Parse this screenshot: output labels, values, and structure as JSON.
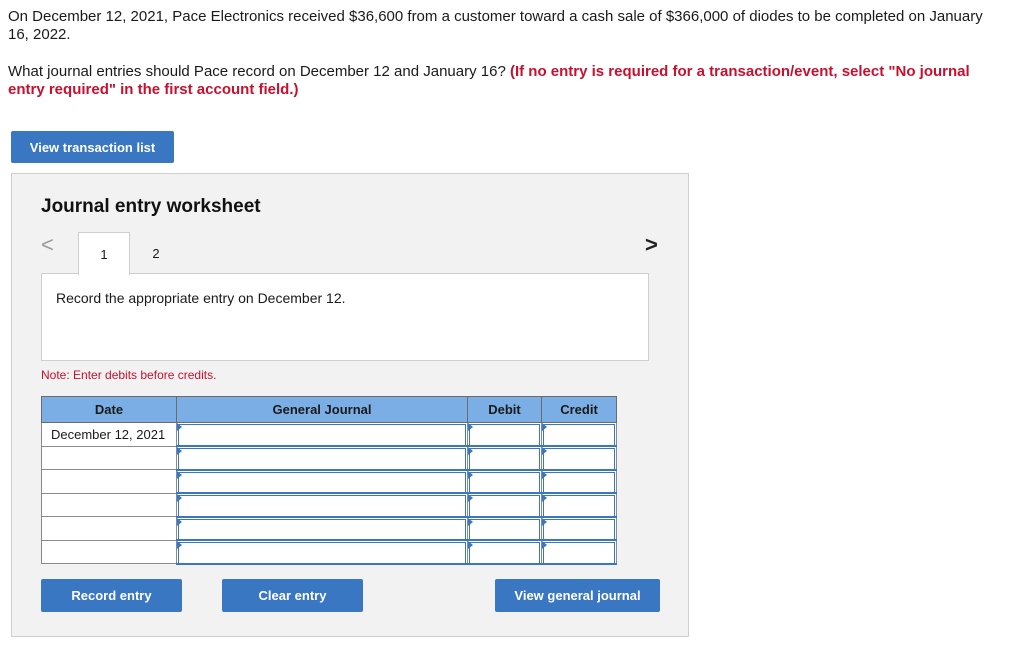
{
  "question": {
    "paragraph1": "On December 12, 2021, Pace Electronics received $36,600 from a customer toward a cash sale of $366,000 of diodes to be completed on January 16, 2022.",
    "paragraph2_plain": "What journal entries should Pace record on December 12 and January 16? ",
    "paragraph2_emphasis": "(If no entry is required for a transaction/event, select \"No journal entry required\" in the first account field.)"
  },
  "buttons": {
    "view_transaction_list": "View transaction list",
    "record_entry": "Record entry",
    "clear_entry": "Clear entry",
    "view_general_journal": "View general journal"
  },
  "worksheet": {
    "title": "Journal entry worksheet",
    "nav": {
      "prev_icon": "chevron-left-icon",
      "prev_glyph": "<",
      "next_icon": "chevron-right-icon",
      "next_glyph": ">"
    },
    "tabs": [
      {
        "label": "1",
        "active": true
      },
      {
        "label": "2",
        "active": false
      }
    ],
    "instruction": "Record the appropriate entry on December 12.",
    "note": "Note: Enter debits before credits."
  },
  "table": {
    "headers": {
      "date": "Date",
      "general_journal": "General Journal",
      "debit": "Debit",
      "credit": "Credit"
    },
    "rows": [
      {
        "date": "December 12, 2021"
      },
      {
        "date": ""
      },
      {
        "date": ""
      },
      {
        "date": ""
      },
      {
        "date": ""
      },
      {
        "date": ""
      }
    ]
  },
  "colors": {
    "button_blue": "#3a77c2",
    "header_blue": "#7aaee4",
    "emphasis_red": "#c8102e",
    "panel_gray": "#f2f2f2"
  }
}
